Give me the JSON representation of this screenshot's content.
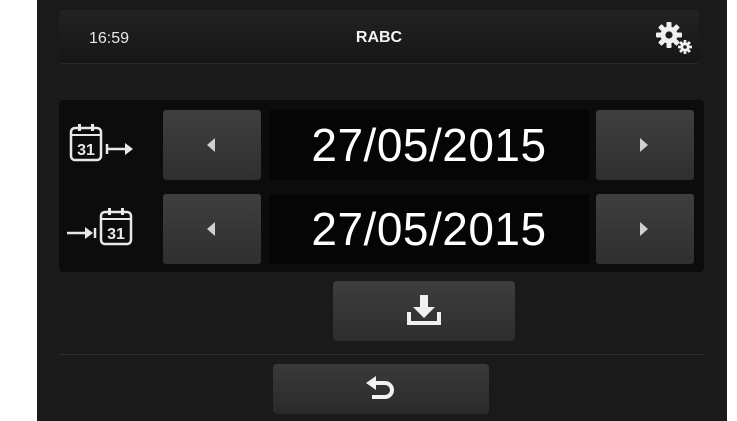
{
  "header": {
    "time": "16:59",
    "title": "RABC",
    "settings_icon": "gears-icon"
  },
  "date_range": {
    "start": {
      "icon": "calendar-start-icon",
      "calendar_day": "31",
      "value": "27/05/2015"
    },
    "end": {
      "icon": "calendar-end-icon",
      "calendar_day": "31",
      "value": "27/05/2015"
    }
  },
  "actions": {
    "download_icon": "download-icon",
    "back_icon": "back-arrow-icon"
  },
  "colors": {
    "background": "#1a1a1a",
    "panel": "#0c0c0c",
    "button": "#383838",
    "text": "#ffffff"
  }
}
